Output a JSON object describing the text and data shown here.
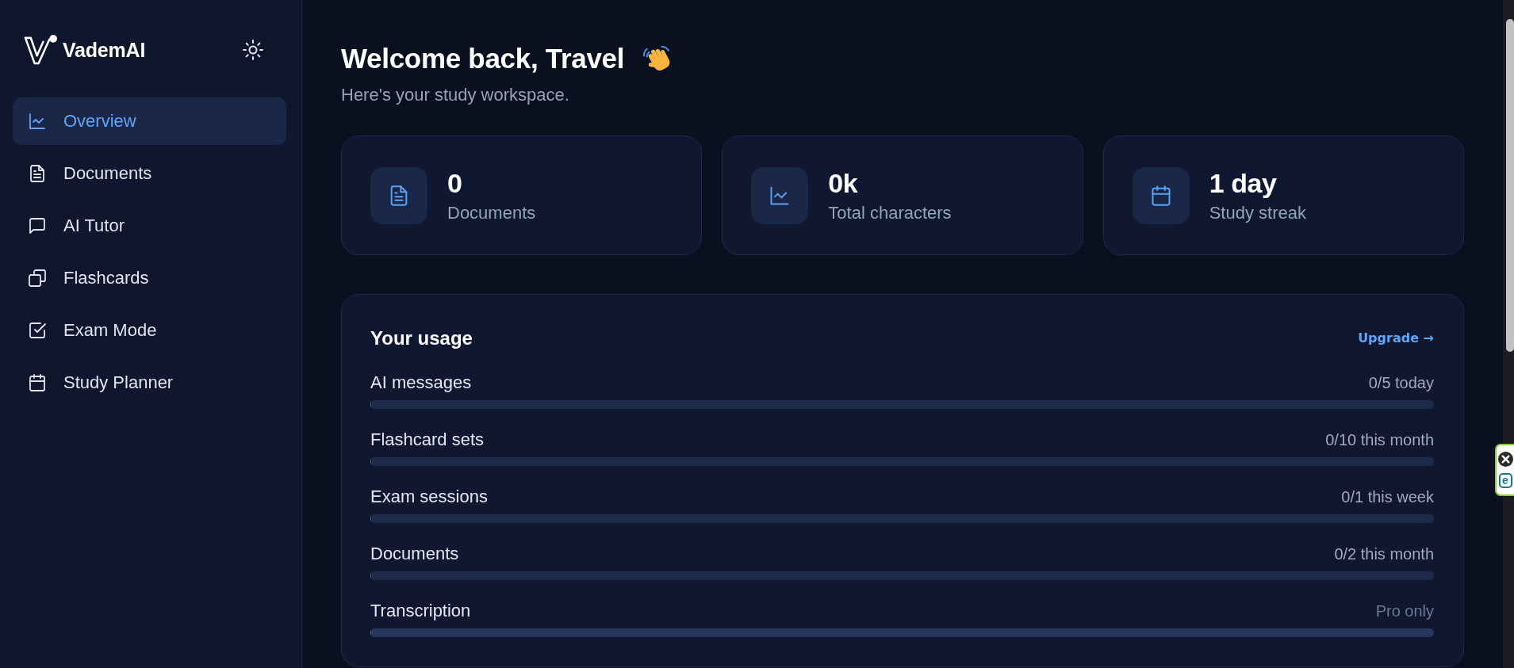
{
  "sidebar": {
    "brand": "VademAI",
    "nav_items": [
      {
        "label": "Overview",
        "selected": true
      },
      {
        "label": "Documents",
        "selected": false
      },
      {
        "label": "AI Tutor",
        "selected": false
      },
      {
        "label": "Flashcards",
        "selected": false
      },
      {
        "label": "Exam Mode",
        "selected": false
      },
      {
        "label": "Study Planner",
        "selected": false
      }
    ]
  },
  "header": {
    "title": "Welcome back, Travel",
    "subtitle": "Here's your study workspace."
  },
  "stats": [
    {
      "value": "0",
      "label": "Documents"
    },
    {
      "value": "0k",
      "label": "Total characters"
    },
    {
      "value": "1 day",
      "label": "Study streak"
    }
  ],
  "usage": {
    "title": "Your usage",
    "upgrade_link": "Upgrade →",
    "rows": [
      {
        "label": "AI messages",
        "reading": "0/5 today",
        "level": 0,
        "locked": false
      },
      {
        "label": "Flashcard sets",
        "reading": "0/10 this month",
        "level": 0,
        "locked": false
      },
      {
        "label": "Exam sessions",
        "reading": "0/1 this week",
        "level": 0,
        "locked": false
      },
      {
        "label": "Documents",
        "reading": "0/2 this month",
        "level": 0,
        "locked": false
      },
      {
        "label": "Transcription",
        "reading": "Pro only",
        "level": 0,
        "locked": true
      }
    ]
  },
  "extension_widget": {
    "letter": "e"
  }
}
